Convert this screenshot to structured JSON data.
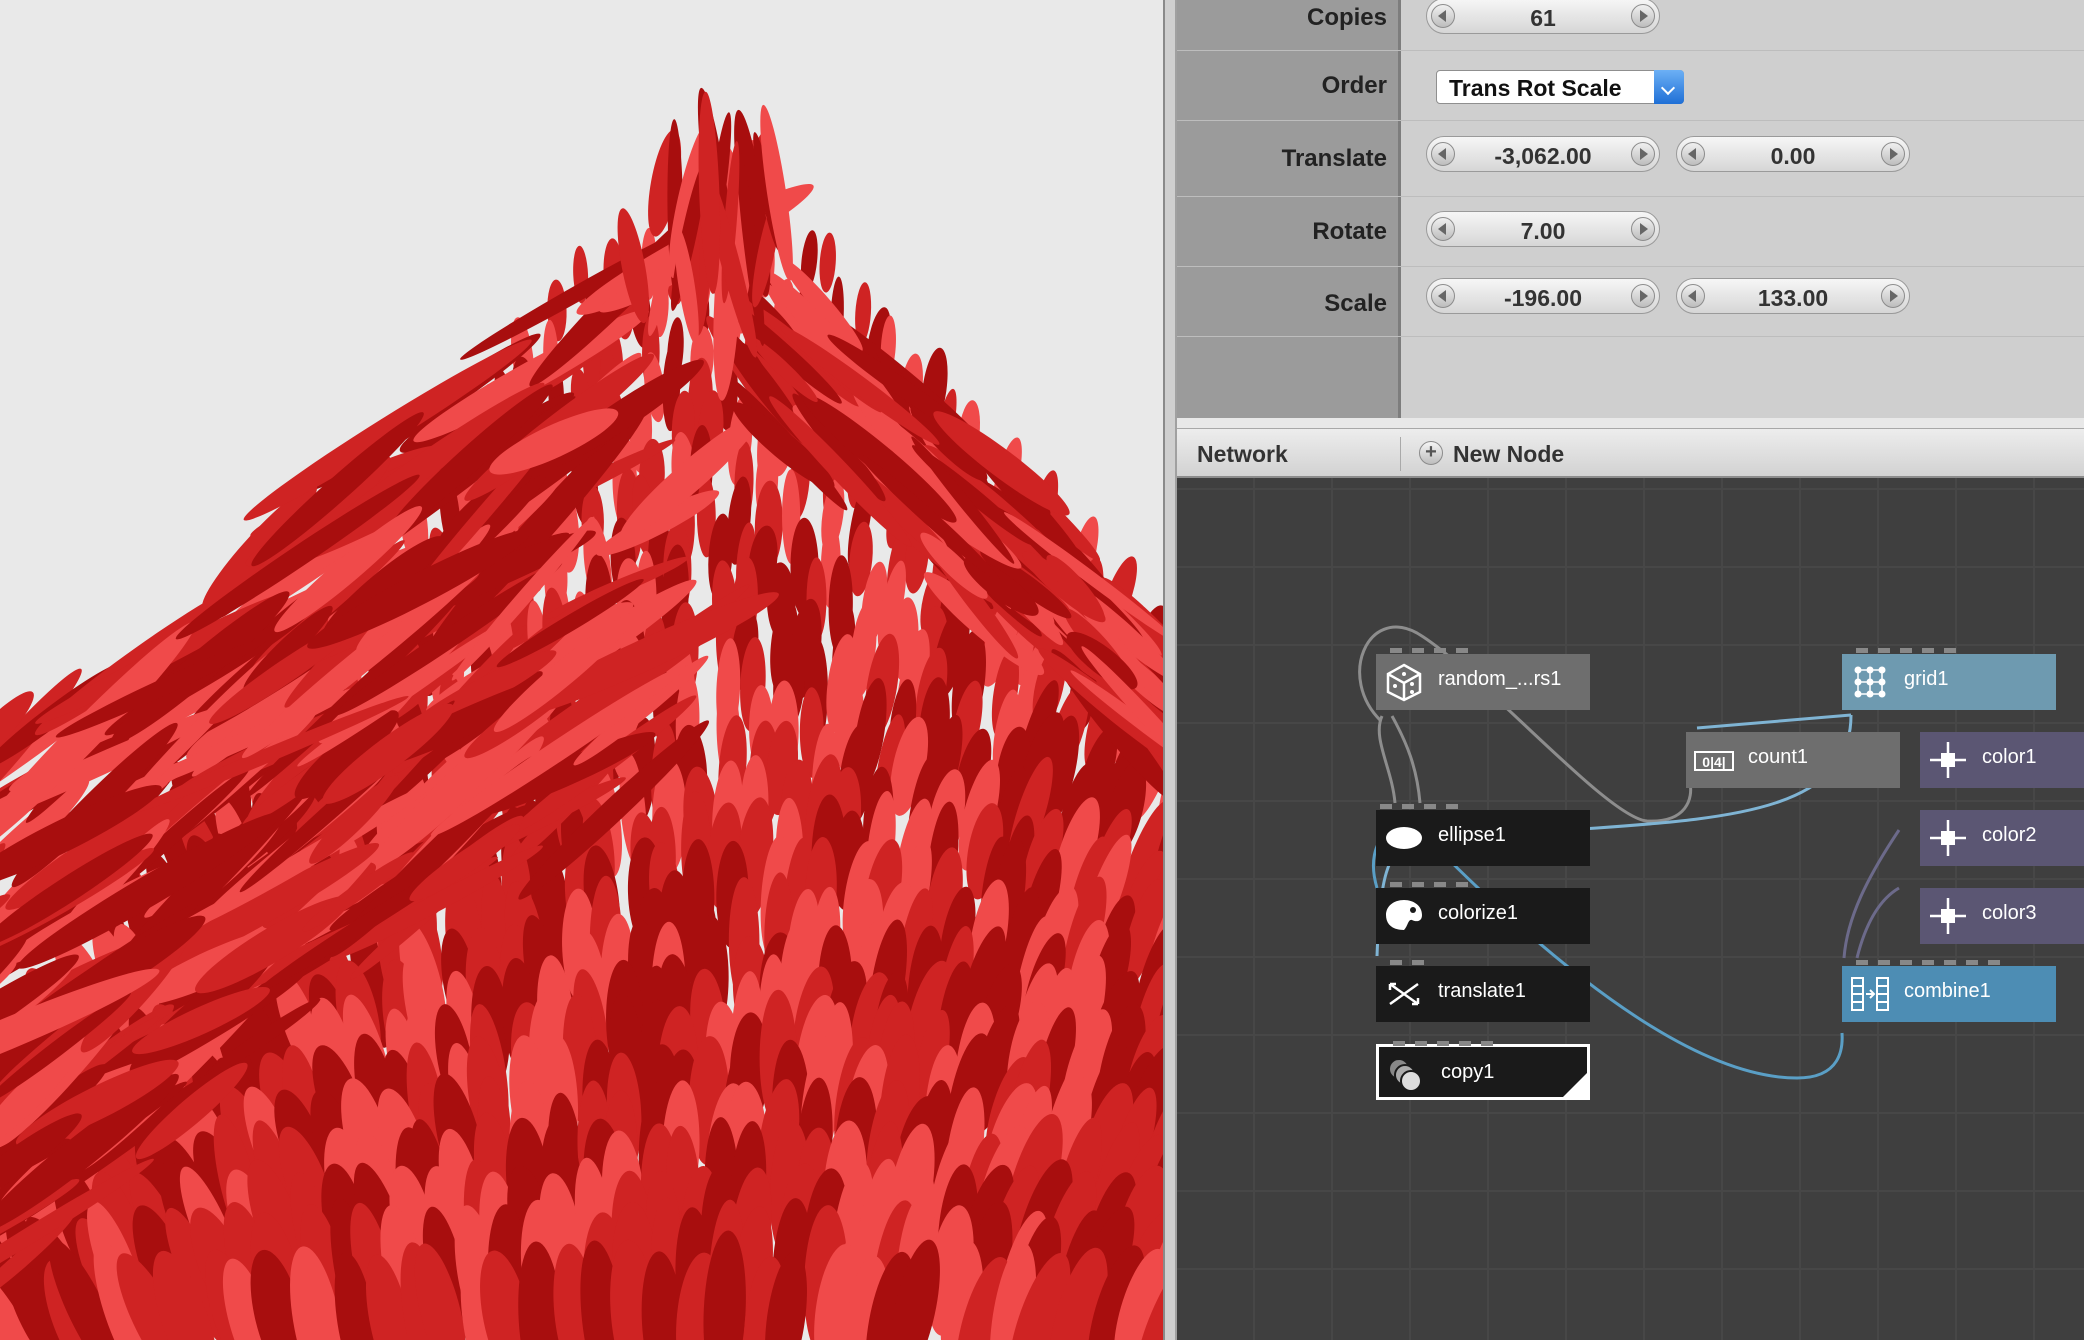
{
  "params": {
    "copies": {
      "label": "Copies",
      "value": "61"
    },
    "order": {
      "label": "Order",
      "value": "Trans Rot Scale"
    },
    "translate": {
      "label": "Translate",
      "x": "-3,062.00",
      "y": "0.00"
    },
    "rotate": {
      "label": "Rotate",
      "value": "7.00"
    },
    "scale": {
      "label": "Scale",
      "x": "-196.00",
      "y": "133.00"
    }
  },
  "network": {
    "title": "Network",
    "new_node": "New Node",
    "nodes": {
      "random": "random_...rs1",
      "ellipse": "ellipse1",
      "colorize": "colorize1",
      "translate": "translate1",
      "copy": "copy1",
      "count": "count1",
      "count_icon_text": "0|4|",
      "grid": "grid1",
      "color1": "color1",
      "color2": "color2",
      "color3": "color3",
      "combine": "combine1"
    }
  },
  "colors": {
    "ellipse_light": "#f04a4a",
    "ellipse_mid": "#cf2323",
    "ellipse_dark": "#a80e0e",
    "connection": "#7fb4d4"
  }
}
